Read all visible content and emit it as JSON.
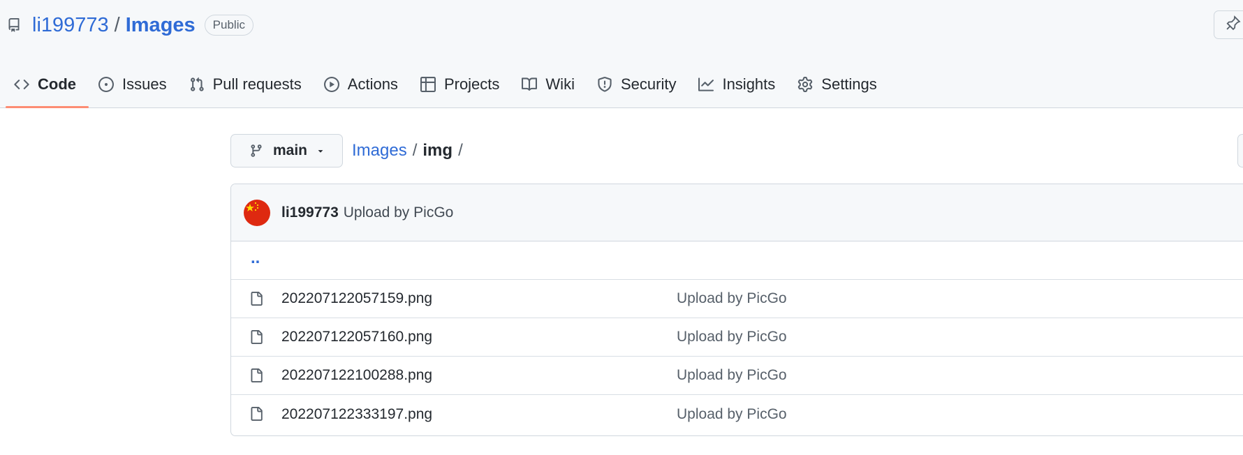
{
  "repo": {
    "owner": "li199773",
    "separator": "/",
    "name": "Images",
    "visibility": "Public"
  },
  "tabs": [
    {
      "label": "Code",
      "icon": "code-icon",
      "selected": true
    },
    {
      "label": "Issues",
      "icon": "issue-opened-icon"
    },
    {
      "label": "Pull requests",
      "icon": "git-pull-request-icon"
    },
    {
      "label": "Actions",
      "icon": "play-icon"
    },
    {
      "label": "Projects",
      "icon": "table-icon"
    },
    {
      "label": "Wiki",
      "icon": "book-icon"
    },
    {
      "label": "Security",
      "icon": "shield-icon"
    },
    {
      "label": "Insights",
      "icon": "graph-icon"
    },
    {
      "label": "Settings",
      "icon": "gear-icon"
    }
  ],
  "branch": {
    "name": "main"
  },
  "breadcrumb": {
    "root": "Images",
    "sep1": "/",
    "current": "img",
    "sep2": "/"
  },
  "latest_commit": {
    "author": "li199773",
    "message": "Upload by PicGo"
  },
  "parent_dir": "..",
  "files": [
    {
      "name": "202207122057159.png",
      "commit": "Upload by PicGo"
    },
    {
      "name": "202207122057160.png",
      "commit": "Upload by PicGo"
    },
    {
      "name": "202207122100288.png",
      "commit": "Upload by PicGo"
    },
    {
      "name": "202207122333197.png",
      "commit": "Upload by PicGo"
    }
  ],
  "colors": {
    "link": "#2f6bd6",
    "tab_underline": "#fd8c73",
    "header_bg": "#f6f8fa",
    "border": "#d0d7de"
  }
}
